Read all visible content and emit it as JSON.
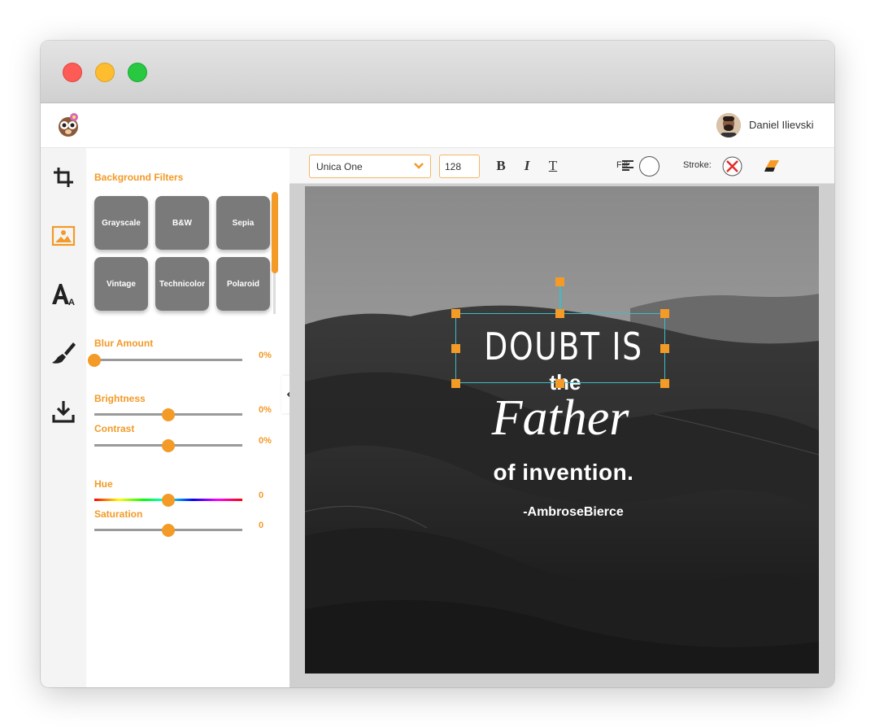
{
  "header": {
    "username": "Daniel Ilievski"
  },
  "sidebar": {
    "icons": [
      "crop-icon",
      "image-icon",
      "text-icon",
      "brush-icon",
      "download-icon"
    ]
  },
  "panel": {
    "filters_title": "Background Filters",
    "filters": [
      {
        "label": "Grayscale"
      },
      {
        "label": "B&W"
      },
      {
        "label": "Sepia"
      },
      {
        "label": "Vintage"
      },
      {
        "label": "Technicolor"
      },
      {
        "label": "Polaroid"
      }
    ],
    "sliders": {
      "blur": {
        "label": "Blur Amount",
        "value": "0%",
        "level": 0
      },
      "brightness": {
        "label": "Brightness",
        "value": "0%",
        "level": 0.5
      },
      "contrast": {
        "label": "Contrast",
        "value": "0%",
        "level": 0.5
      },
      "hue": {
        "label": "Hue",
        "value": "0",
        "level": 0.5
      },
      "saturation": {
        "label": "Saturation",
        "value": "0",
        "level": 0.5
      }
    }
  },
  "toolbar": {
    "font": "Unica One",
    "font_size": "128",
    "bold_label": "B",
    "italic_label": "I",
    "underline_label": "T",
    "fill_label": "Fill:",
    "stroke_label": "Stroke:"
  },
  "canvas": {
    "line1": "DOUBT IS",
    "line2": "the",
    "line3": "Father",
    "line4": "of invention.",
    "author": "-AmbroseBierce"
  },
  "colors": {
    "accent": "#f39a27",
    "selection": "#3bbfc4",
    "filter_button": "#7a7a7a"
  }
}
